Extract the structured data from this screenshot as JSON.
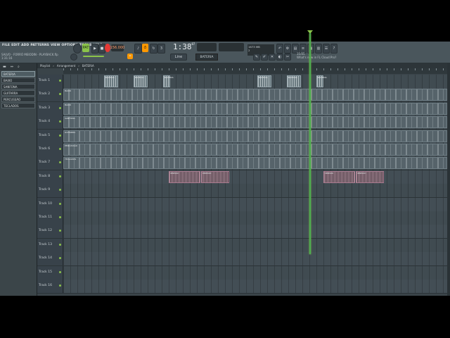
{
  "menu": [
    "FILE",
    "EDIT",
    "ADD",
    "PATTERNS",
    "VIEW",
    "OPTIONS",
    "TOOLS",
    "HELP"
  ],
  "toolbar": {
    "pat_label": "PAT",
    "tempo": "156.000",
    "time": "1:38",
    "time_sub": "07",
    "cpu_ram": "1673 MB",
    "cpu_count": "2",
    "pattern_selector": "BATERIA",
    "snap_label": "Line",
    "hint_line1": "SALVO - FORRÓ MEIODIN - PLAYBACK.flp",
    "hint_line2": "1:31:16",
    "hint_right1": "11/05",
    "hint_right2": "What's new in FL Cloud Pro?",
    "step_label": "Stutter D4"
  },
  "browser": {
    "channels": [
      "BATERIA",
      "BAIXO",
      "SANFONA",
      "GUITARRA",
      "PERCUSSÃO",
      "TECLADOS"
    ],
    "selected": 0
  },
  "playlist": {
    "title": "Playlist",
    "path": "Arrangement",
    "pattern": "BATERIA"
  },
  "tracks": [
    {
      "name": "Track 1"
    },
    {
      "name": "Track 2"
    },
    {
      "name": "Track 3"
    },
    {
      "name": "Track 4"
    },
    {
      "name": "Track 5"
    },
    {
      "name": "Track 6"
    },
    {
      "name": "Track 7"
    },
    {
      "name": "Track 8"
    },
    {
      "name": "Track 9"
    },
    {
      "name": "Track 10"
    },
    {
      "name": "Track 11"
    },
    {
      "name": "Track 12"
    },
    {
      "name": "Track 13"
    },
    {
      "name": "Track 14"
    },
    {
      "name": "Track 15"
    },
    {
      "name": "Track 16"
    }
  ],
  "clip_labels": {
    "bateria": "BATERIA",
    "baixo": "BAIXO",
    "sanfona": "SANFONA",
    "guitarra": "GUITARRA",
    "percussao": "PERCUSSÃO",
    "teclados": "TECLADOS",
    "audio": "VERSÃO"
  }
}
